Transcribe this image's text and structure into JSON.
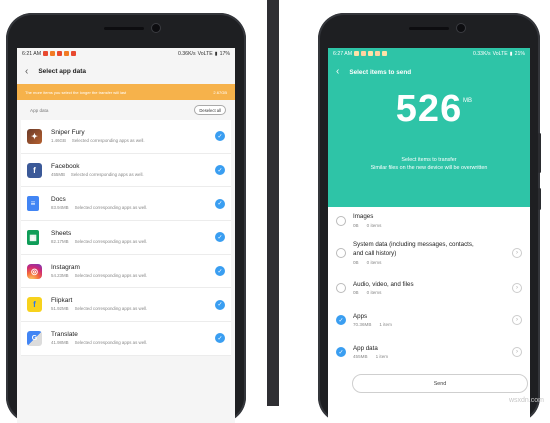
{
  "colors": {
    "accent_teal": "#2ec4a7",
    "check_blue": "#3a9ef1",
    "warning_orange": "#f6b24b"
  },
  "left_phone": {
    "status": {
      "time": "6:21 AM",
      "network": "0.36K/s",
      "carrier": "VoLTE",
      "battery": "17%"
    },
    "header": {
      "title": "Select app data"
    },
    "warning": {
      "text": "The more items you select the longer the transfer will last",
      "size": "2.67GB"
    },
    "list_header": {
      "label": "App data",
      "deselect_label": "Deselect all"
    },
    "apps": [
      {
        "name": "Sniper Fury",
        "size": "1.46GB",
        "note": "Selected corresponding apps as well.",
        "icon": "sniper-fury-icon"
      },
      {
        "name": "Facebook",
        "size": "455MB",
        "note": "Selected corresponding apps as well.",
        "icon": "facebook-icon"
      },
      {
        "name": "Docs",
        "size": "83.94MB",
        "note": "Selected corresponding apps as well.",
        "icon": "docs-icon"
      },
      {
        "name": "Sheets",
        "size": "82.17MB",
        "note": "Selected corresponding apps as well.",
        "icon": "sheets-icon"
      },
      {
        "name": "Instagram",
        "size": "54.23MB",
        "note": "Selected corresponding apps as well.",
        "icon": "instagram-icon"
      },
      {
        "name": "Flipkart",
        "size": "51.92MB",
        "note": "Selected corresponding apps as well.",
        "icon": "flipkart-icon"
      },
      {
        "name": "Translate",
        "size": "41.98MB",
        "note": "Selected corresponding apps as well.",
        "icon": "translate-icon"
      }
    ]
  },
  "right_phone": {
    "status": {
      "time": "6:27 AM",
      "network": "0.33K/s",
      "carrier": "VoLTE",
      "battery": "21%"
    },
    "header": {
      "title": "Select items to send"
    },
    "total": {
      "value": "526",
      "unit": "MB"
    },
    "transfer_note_1": "Select items to transfer",
    "transfer_note_2": "Similar files on the new device will be overwritten",
    "categories": [
      {
        "name": "Images",
        "size": "0B",
        "count": "0 items",
        "selected": false,
        "chevron": false
      },
      {
        "name": "System data (including messages, contacts, and call history)",
        "size": "0B",
        "count": "0 items",
        "selected": false,
        "chevron": true
      },
      {
        "name": "Audio, video, and files",
        "size": "0B",
        "count": "0 items",
        "selected": false,
        "chevron": true
      },
      {
        "name": "Apps",
        "size": "70.36MB",
        "count": "1 item",
        "selected": true,
        "chevron": true
      },
      {
        "name": "App data",
        "size": "455MB",
        "count": "1 item",
        "selected": true,
        "chevron": true
      }
    ],
    "send_label": "Send"
  },
  "watermark": "wsxdn.com"
}
